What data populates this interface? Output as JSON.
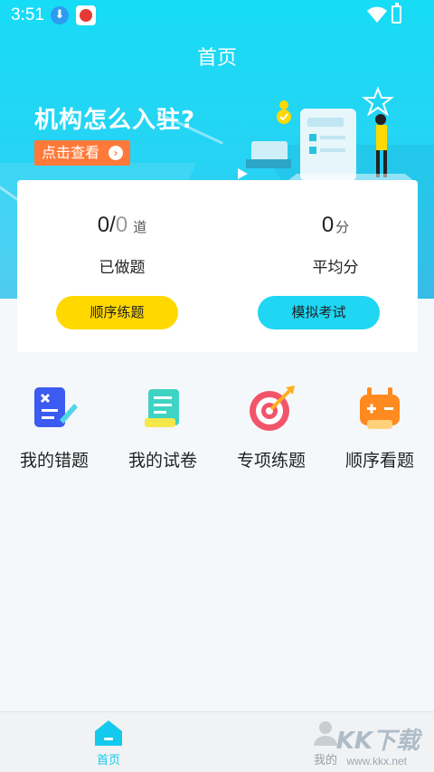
{
  "status_bar": {
    "time": "3:51"
  },
  "header": {
    "title": "首页"
  },
  "banner": {
    "title": "机构怎么入驻?",
    "button_label": "点击查看"
  },
  "stats": {
    "done": {
      "value_done": "0",
      "separator": "/",
      "value_total": "0",
      "unit": "道",
      "label": "已做题"
    },
    "average": {
      "value": "0",
      "unit": "分",
      "label": "平均分"
    }
  },
  "buttons": {
    "order_practice": "顺序练题",
    "mock_exam": "模拟考试"
  },
  "features": [
    {
      "label": "我的错题",
      "icon": "wrong-questions-icon"
    },
    {
      "label": "我的试卷",
      "icon": "my-papers-icon"
    },
    {
      "label": "专项练题",
      "icon": "target-icon"
    },
    {
      "label": "顺序看题",
      "icon": "game-controller-icon"
    }
  ],
  "tabbar": {
    "items": [
      {
        "label": "首页",
        "icon": "home-icon",
        "active": true
      },
      {
        "label": "我的",
        "icon": "user-icon",
        "active": false
      }
    ]
  },
  "watermark": {
    "text": "KK下载",
    "url": "www.kkx.net"
  },
  "colors": {
    "accent": "#1fd6f3",
    "yellow": "#ffd800",
    "orange": "#ff7a3a"
  }
}
